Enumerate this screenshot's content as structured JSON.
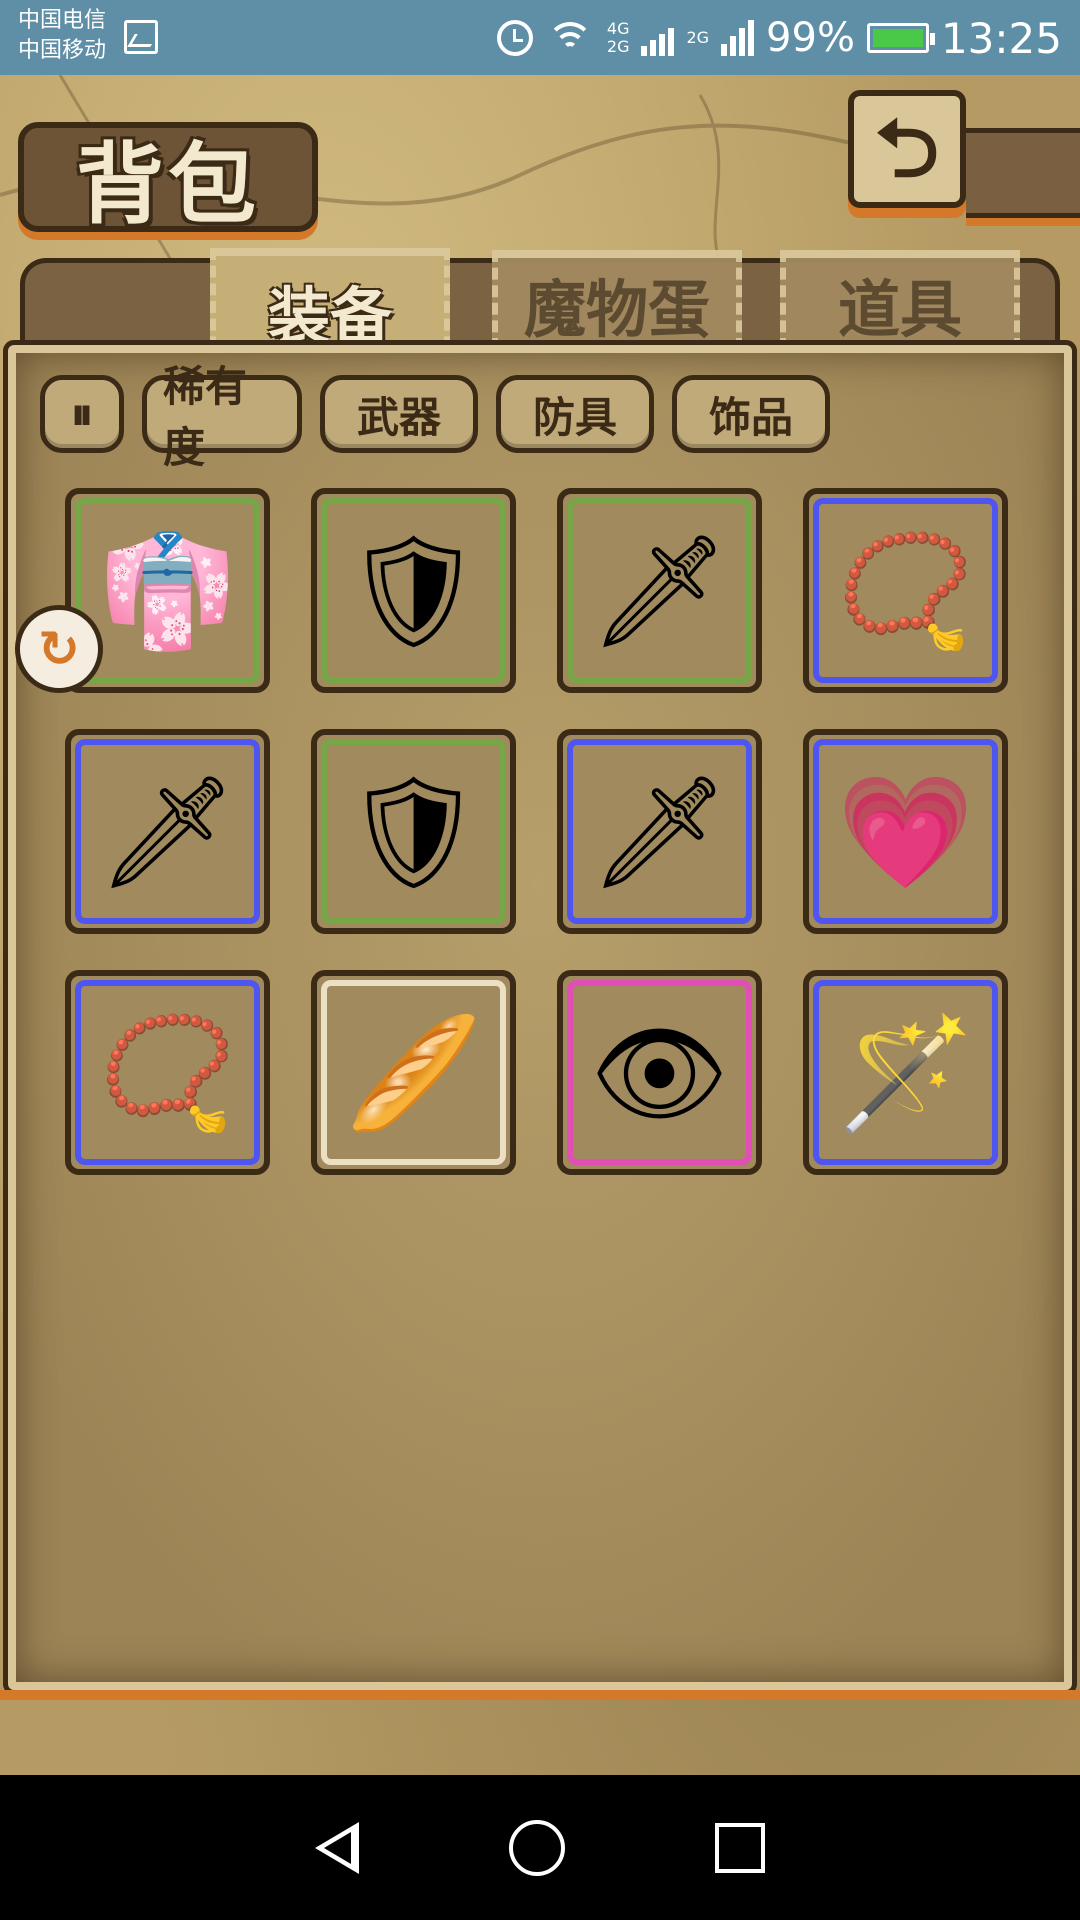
{
  "status_bar": {
    "carrier_1": "中国电信",
    "carrier_2": "中国移动",
    "net_1": "4G",
    "net_2": "2G",
    "net_3": "2G",
    "battery": "99%",
    "time": "13:25",
    "icons": [
      "gallery-icon",
      "alarm-icon",
      "wifi-icon",
      "signal-icon",
      "battery-icon"
    ]
  },
  "header": {
    "title": "背包",
    "back_icon": "⮌"
  },
  "tabs": [
    {
      "label": "装备",
      "active": true
    },
    {
      "label": "魔物蛋",
      "active": false
    },
    {
      "label": "道具",
      "active": false
    }
  ],
  "filters": {
    "sort_icon": "⏸",
    "rarity": "稀有度",
    "weapon": "武器",
    "armor": "防具",
    "accessory": "饰品"
  },
  "lock_badge": "↻",
  "items": [
    {
      "name": "sailor-uniform",
      "glyph": "👘",
      "rarity": "green"
    },
    {
      "name": "round-shield",
      "glyph": "🛡",
      "rarity": "green"
    },
    {
      "name": "short-sword",
      "glyph": "🗡",
      "rarity": "green"
    },
    {
      "name": "beetle-necklace",
      "glyph": "📿",
      "rarity": "blue"
    },
    {
      "name": "long-sword",
      "glyph": "🗡",
      "rarity": "blue"
    },
    {
      "name": "round-shield",
      "glyph": "🛡",
      "rarity": "green"
    },
    {
      "name": "long-sword",
      "glyph": "🗡",
      "rarity": "blue"
    },
    {
      "name": "heart-ring",
      "glyph": "💗",
      "rarity": "blue"
    },
    {
      "name": "beetle-necklace",
      "glyph": "📿",
      "rarity": "blue"
    },
    {
      "name": "bread",
      "glyph": "🥖",
      "rarity": "cream"
    },
    {
      "name": "eye-charm",
      "glyph": "👁",
      "rarity": "pink"
    },
    {
      "name": "heart-scepter",
      "glyph": "🪄",
      "rarity": "blue"
    }
  ],
  "colors": {
    "rarity_green": "#76a646",
    "rarity_blue": "#4e55f0",
    "rarity_pink": "#e24db6",
    "rarity_cream": "#ece0c4",
    "accent_orange": "#d4782a",
    "frame_dark": "#3b2a16"
  }
}
